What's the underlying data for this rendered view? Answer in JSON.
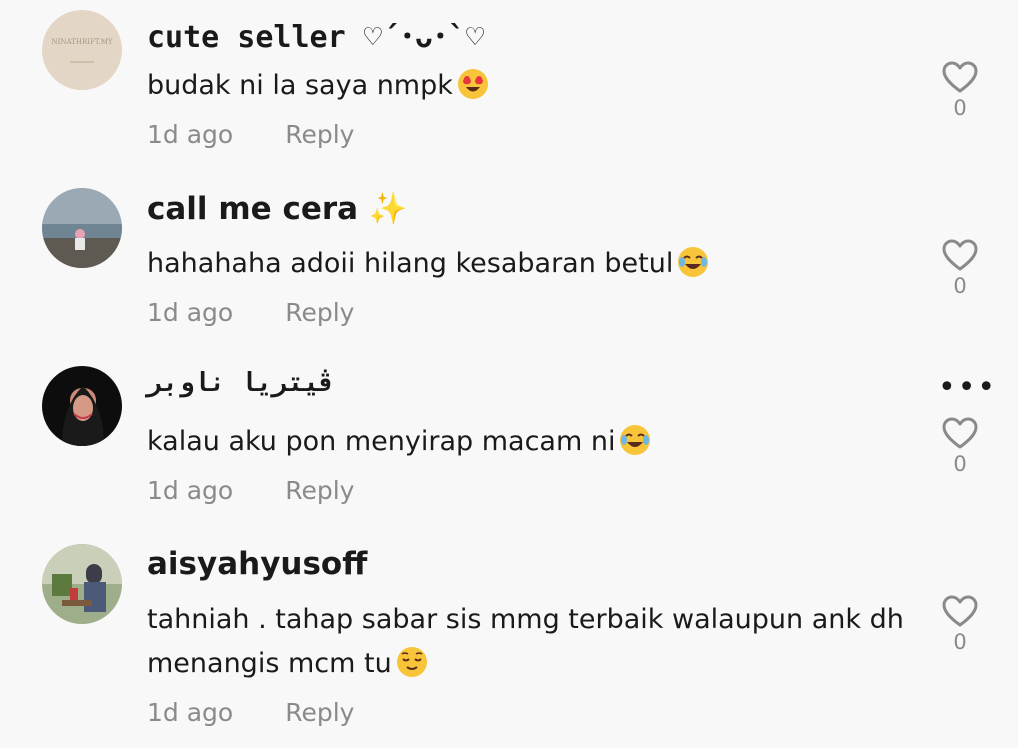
{
  "comments": [
    {
      "username": "cute seller ♡´･ᴗ･`♡",
      "text": "budak ni la saya nmpk",
      "emoji": "heart-eyes-emoji",
      "time": "1d ago",
      "reply": "Reply",
      "likes": "0",
      "avatar_label": "NINATHRIFT.MY"
    },
    {
      "username": "call me cera ✨",
      "text": "hahahaha adoii hilang kesabaran betul",
      "emoji": "tears-of-joy-emoji",
      "time": "1d ago",
      "reply": "Reply",
      "likes": "0"
    },
    {
      "username": "ڤيتريا ناوبر",
      "text": "kalau aku pon menyirap macam ni",
      "emoji": "tears-of-joy-emoji",
      "time": "1d ago",
      "reply": "Reply",
      "likes": "0",
      "more": "•••"
    },
    {
      "username": "aisyahyusoff",
      "text": "tahniah . tahap sabar sis mmg terbaik walaupun ank dh menangis mcm tu",
      "emoji": "relieved-face-emoji",
      "time": "1d ago",
      "reply": "Reply",
      "likes": "0"
    }
  ],
  "colors": {
    "background": "#f8f8f8",
    "text": "#1a1a1a",
    "muted": "#8a8a8a",
    "emoji_yellow": "#f7c43a"
  }
}
